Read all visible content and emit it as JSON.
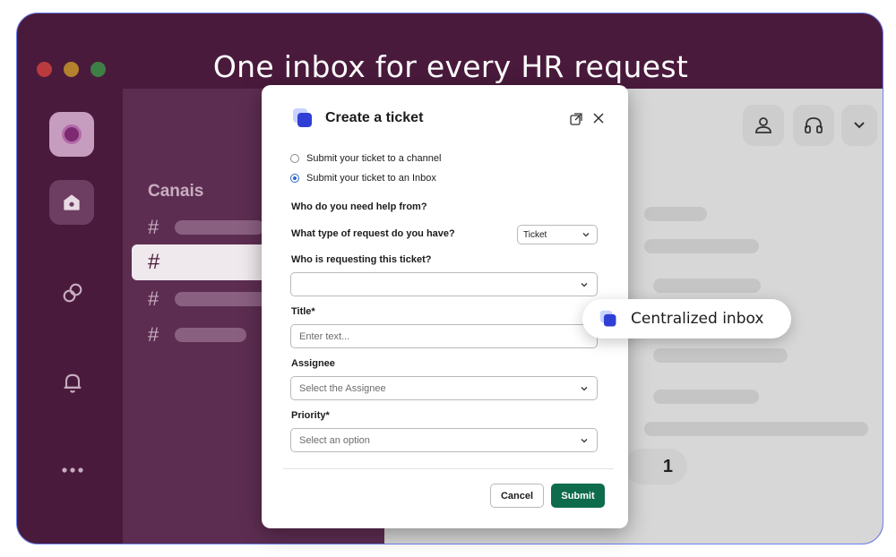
{
  "headline": "One inbox for every HR request",
  "sidebar": {
    "channels_title": "Canais"
  },
  "reaction": {
    "count": "1"
  },
  "modal": {
    "title": "Create a ticket",
    "radio_channel": "Submit your ticket to a channel",
    "radio_inbox": "Submit your ticket to an Inbox",
    "radio_selected": "inbox",
    "who_help": "Who do you need help from?",
    "request_type_label": "What type of request do you have?",
    "request_type_value": "Ticket",
    "requester_label": "Who is requesting this ticket?",
    "requester_value": "",
    "title_label": "Title*",
    "title_placeholder": "Enter text...",
    "assignee_label": "Assignee",
    "assignee_placeholder": "Select the Assignee",
    "priority_label": "Priority*",
    "priority_placeholder": "Select an option",
    "cancel_label": "Cancel",
    "submit_label": "Submit"
  },
  "callout": {
    "text": "Centralized inbox"
  },
  "colors": {
    "aubergine": "#4a1a3c",
    "submit_green": "#0e6b4c",
    "accent_blue": "#2e65c9",
    "frame_border": "#6a82f0"
  },
  "icons": [
    "workspace-icon",
    "home-icon",
    "dms-icon",
    "bell-icon",
    "more-icon",
    "user-icon",
    "headphones-icon",
    "chevron-down-icon",
    "ticket-app-logo-icon",
    "expand-icon",
    "close-icon"
  ]
}
